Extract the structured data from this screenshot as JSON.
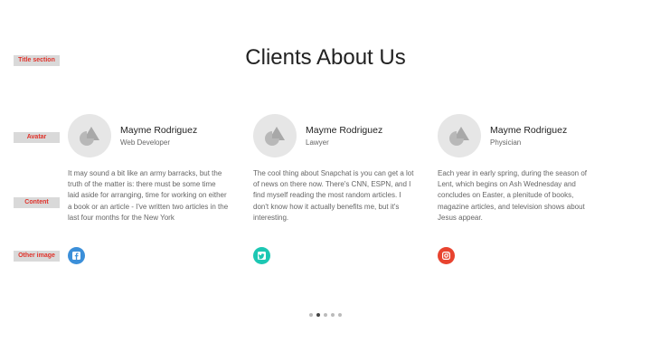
{
  "annotations": {
    "title": "Title section",
    "avatar": "Avatar",
    "content": "Content",
    "other_image": "Other image"
  },
  "section": {
    "title": "Clients About Us"
  },
  "testimonials": [
    {
      "name": "Mayme Rodriguez",
      "role": "Web Developer",
      "text": "It may sound a bit like an army barracks, but the truth of the matter is: there must be some time laid aside for arranging, time for working on either a book or an article - I've written two articles in the last four months for the New York",
      "social_icon": "facebook-icon",
      "social_color": "#3b8fd9"
    },
    {
      "name": "Mayme Rodriguez",
      "role": "Lawyer",
      "text": "The cool thing about Snapchat is you can get a lot of news on there now. There's CNN, ESPN, and I find myself reading the most random articles. I don't know how it actually benefits me, but it's interesting.",
      "social_icon": "twitter-icon",
      "social_color": "#1cc7b3"
    },
    {
      "name": "Mayme Rodriguez",
      "role": "Physician",
      "text": "Each year in early spring, during the season of Lent, which begins on Ash Wednesday and concludes on Easter, a plenitude of books, magazine articles, and television shows about Jesus appear.",
      "social_icon": "instagram-icon",
      "social_color": "#e8432f"
    }
  ],
  "pagination": {
    "count": 5,
    "active": 2
  }
}
